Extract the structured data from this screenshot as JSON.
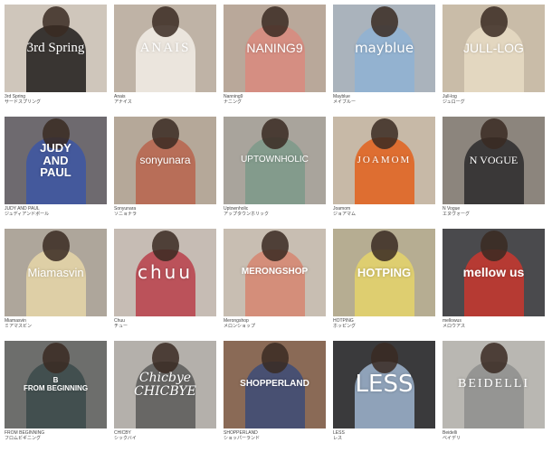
{
  "brands": [
    {
      "logo": "3rd Spring",
      "en": "3rd Spring",
      "ja": "サードスプリング",
      "bg": "#cfc6bb",
      "fig": "#1f1b1a",
      "style": "serif",
      "size": 15
    },
    {
      "logo": "ANAIS",
      "en": "Anais",
      "ja": "アナイス",
      "bg": "#bfb3a6",
      "fig": "#f2ede6",
      "style": "serif-spaced",
      "size": 15
    },
    {
      "logo": "NANING9",
      "en": "Nanning9",
      "ja": "ナニング",
      "bg": "#b9a89a",
      "fig": "#d98a7e",
      "style": "sans",
      "size": 14
    },
    {
      "logo": "mayblue",
      "en": "Mayblue",
      "ja": "メイブルー",
      "bg": "#aab3bc",
      "fig": "#8fb2d4",
      "style": "sans-light",
      "size": 15
    },
    {
      "logo": "JULL-LOG",
      "en": "Jull-log",
      "ja": "ジュローグ",
      "bg": "#c9bca8",
      "fig": "#e8dcc4",
      "style": "sans",
      "size": 14
    },
    {
      "logo": "JUDY\nAND\nPAUL",
      "en": "JUDY AND PAUL",
      "ja": "ジュディアンドポール",
      "bg": "#6e6a6f",
      "fig": "#3d56a5",
      "style": "sans-bold",
      "size": 13
    },
    {
      "logo": "sonyunara",
      "en": "Sonyunara",
      "ja": "ソニョナラ",
      "bg": "#b5a899",
      "fig": "#b9644c",
      "style": "sans",
      "size": 12
    },
    {
      "logo": "UPTOWNHOLIC",
      "en": "Uptownholic",
      "ja": "アップタウンホリック",
      "bg": "#a9a49c",
      "fig": "#7d9a8a",
      "style": "sans",
      "size": 10
    },
    {
      "logo": "JOAMOM",
      "en": "Joamom",
      "ja": "ジョアマム",
      "bg": "#c7b9a7",
      "fig": "#e2601c",
      "style": "serif-spaced",
      "size": 11
    },
    {
      "logo": "N VOGUE",
      "en": "N Vogue",
      "ja": "エヌヴォーグ",
      "bg": "#8c857d",
      "fig": "#2b2a2c",
      "style": "serif",
      "size": 12
    },
    {
      "logo": "Miamasvin",
      "en": "Miamasvin",
      "ja": "ミアマスビン",
      "bg": "#aea69b",
      "fig": "#e6d6a8",
      "style": "sans",
      "size": 13
    },
    {
      "logo": "chuu",
      "en": "Chuu",
      "ja": "チュー",
      "bg": "#c6bcb4",
      "fig": "#b8404a",
      "style": "sans-wide",
      "size": 20
    },
    {
      "logo": "MERONGSHOP",
      "en": "Merongshop",
      "ja": "メロンショップ",
      "bg": "#c8beb2",
      "fig": "#d68670",
      "style": "sans-bold",
      "size": 10
    },
    {
      "logo": "HOTPING",
      "en": "HOTPING",
      "ja": "ホッピング",
      "bg": "#b6ad92",
      "fig": "#e5d36a",
      "style": "sans-bold",
      "size": 13
    },
    {
      "logo": "mellow us",
      "en": "mellowus",
      "ja": "メロウアス",
      "bg": "#4a4a4d",
      "fig": "#c9372f",
      "style": "sans-bold",
      "size": 14
    },
    {
      "logo": "B\nFROM BEGINNING",
      "en": "FROM BEGINNING",
      "ja": "フロムビギニング",
      "bg": "#6d6e6c",
      "fig": "#3b4a4a",
      "style": "sans-bold",
      "size": 8
    },
    {
      "logo": "Chicbye\nCHICBYE",
      "en": "CHICBY",
      "ja": "シックバイ",
      "bg": "#b4b0ab",
      "fig": "#5b5a58",
      "style": "script",
      "size": 14
    },
    {
      "logo": "SHOPPERLAND",
      "en": "SHOPPERLAND",
      "ja": "ショッパーランド",
      "bg": "#8a6a56",
      "fig": "#3c4b77",
      "style": "sans-bold",
      "size": 10
    },
    {
      "logo": "LESS",
      "en": "LESS",
      "ja": "レス",
      "bg": "#3a3a3c",
      "fig": "#9fb5cf",
      "style": "sans-light",
      "size": 26
    },
    {
      "logo": "BEIDELLI",
      "en": "Beidelli",
      "ja": "ベイデリ",
      "bg": "#b9b7b2",
      "fig": "#8e8f8d",
      "style": "serif-spaced",
      "size": 14
    }
  ]
}
